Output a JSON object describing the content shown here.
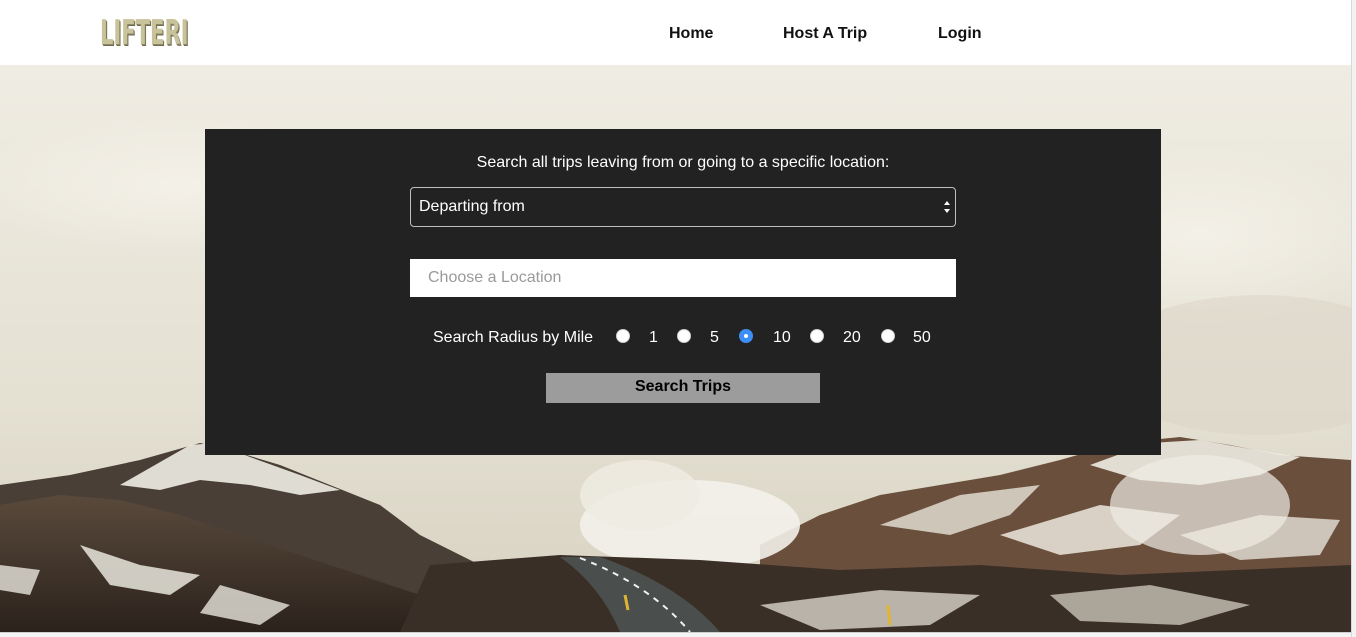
{
  "header": {
    "logo_text": "LIFTERI",
    "nav": [
      {
        "label": "Home"
      },
      {
        "label": "Host A Trip"
      },
      {
        "label": "Login"
      }
    ]
  },
  "search": {
    "heading": "Search all trips leaving from or going to a specific location:",
    "direction_select": {
      "selected": "Departing from"
    },
    "location_input": {
      "value": "",
      "placeholder": "Choose a Location"
    },
    "radius": {
      "label": "Search Radius by Mile",
      "options": [
        "1",
        "5",
        "10",
        "20",
        "50"
      ],
      "selected": "10"
    },
    "submit_label": "Search Trips"
  },
  "colors": {
    "panel_background": "#222222",
    "button_background": "#9c9c9c",
    "radio_accent": "#3b8ef5",
    "logo": "#c8c39a"
  }
}
